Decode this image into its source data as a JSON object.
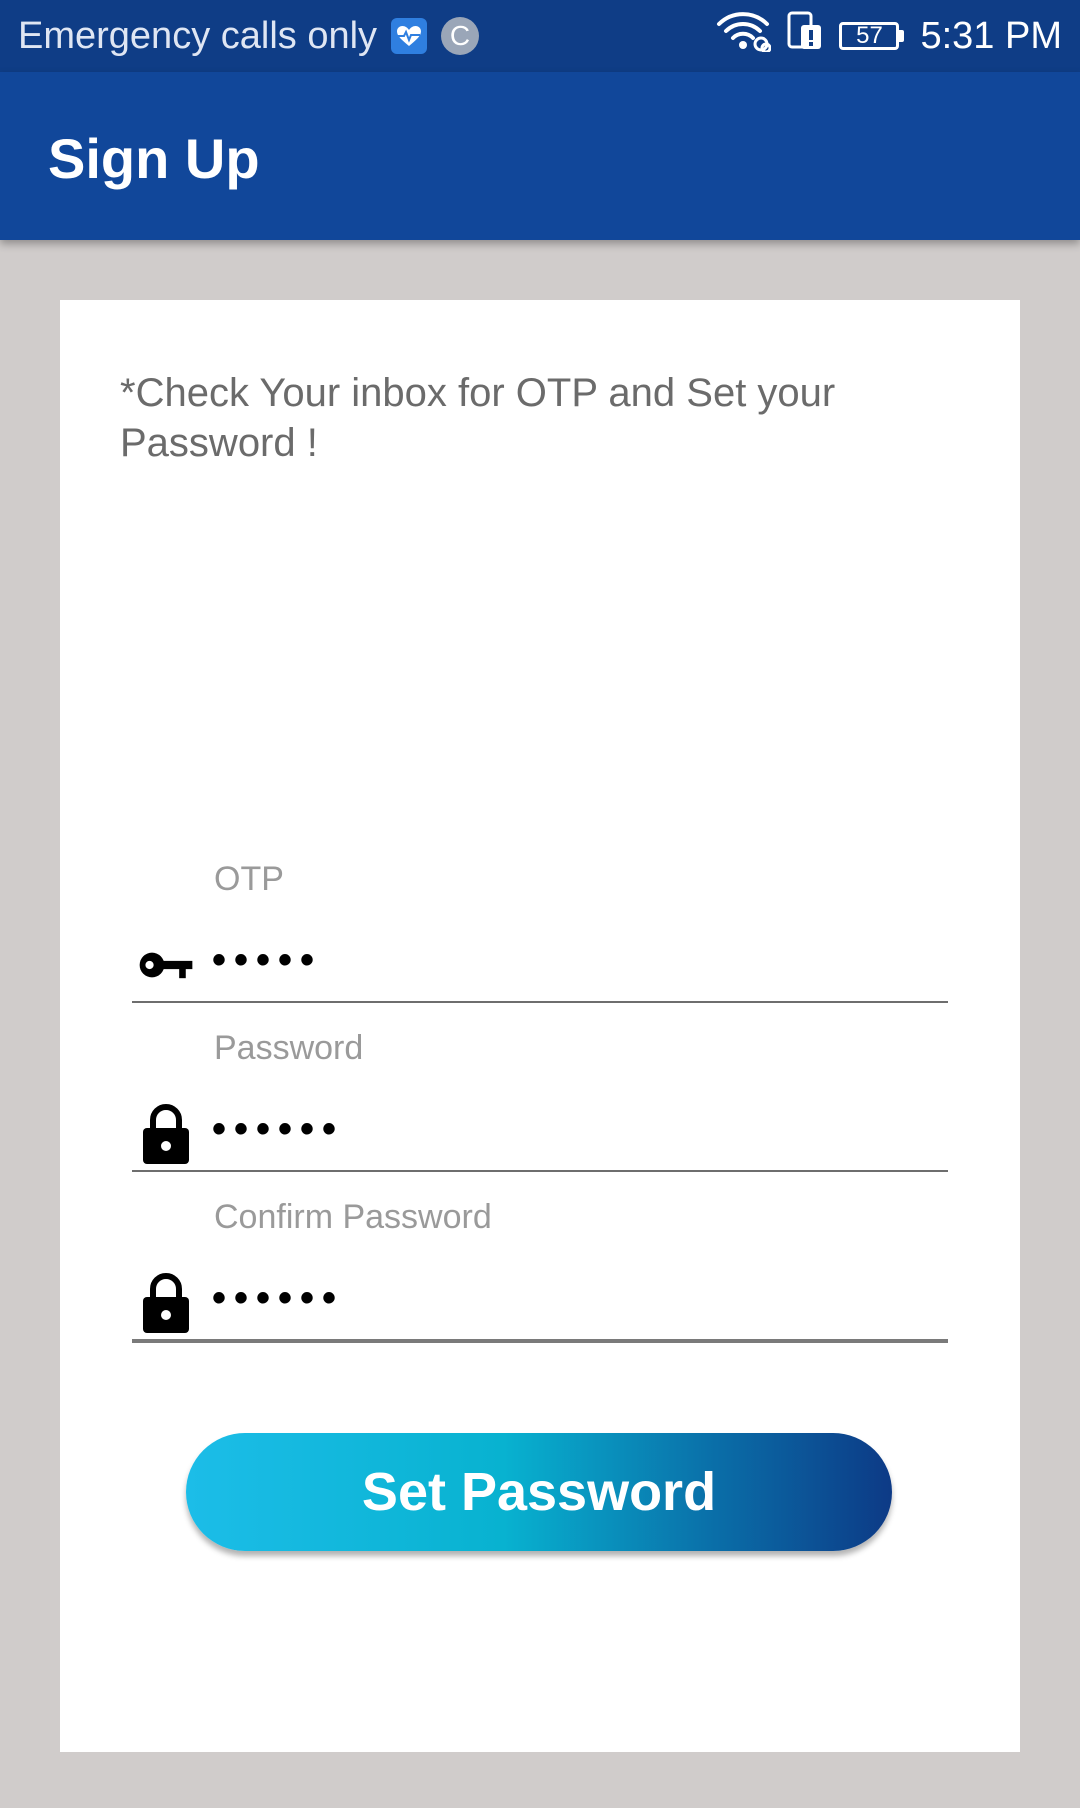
{
  "status_bar": {
    "carrier_text": "Emergency calls only",
    "left_icons": [
      "health-icon",
      "c-icon"
    ],
    "c_icon_letter": "C",
    "battery_level": "57",
    "time": "5:31 PM"
  },
  "app_bar": {
    "title": "Sign Up",
    "color": "#11479a"
  },
  "form": {
    "instructions": "*Check Your inbox for OTP and Set your Password !",
    "fields": [
      {
        "label": "OTP",
        "value": "•••••",
        "icon": "key-icon"
      },
      {
        "label": "Password",
        "value": "••••••",
        "icon": "lock-icon"
      },
      {
        "label": "Confirm Password",
        "value": "••••••",
        "icon": "lock-icon"
      }
    ],
    "submit_label": "Set Password"
  },
  "colors": {
    "status_bar": "#0f3d86",
    "background": "#d0cccb",
    "button_gradient_start": "#1cbde8",
    "button_gradient_end": "#0d3a86"
  }
}
